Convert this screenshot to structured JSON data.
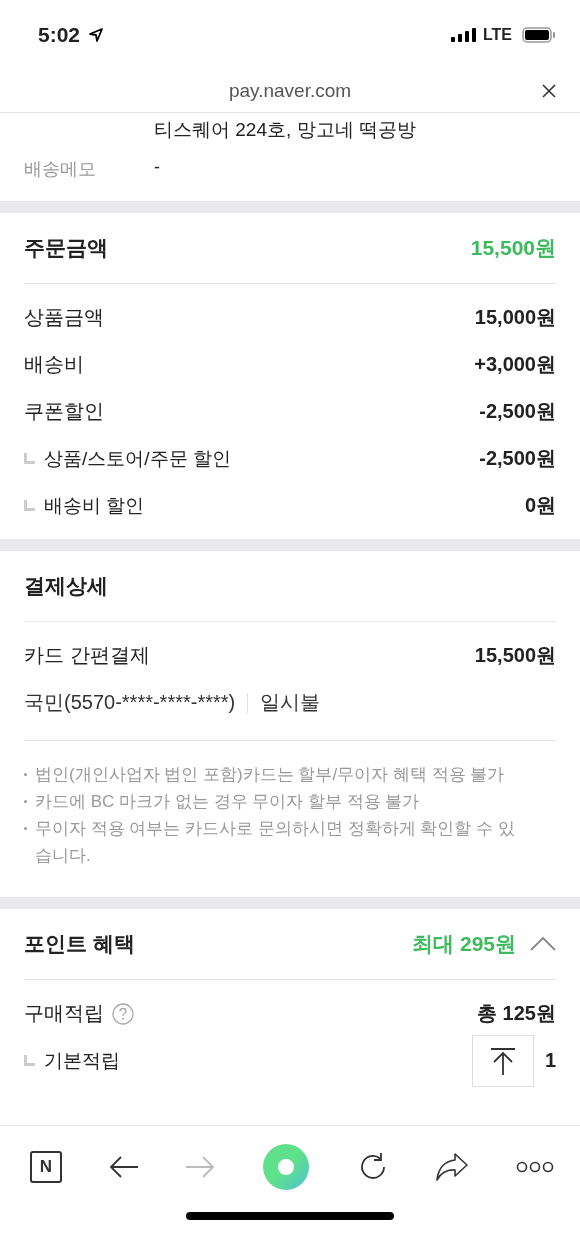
{
  "status_bar": {
    "time": "5:02",
    "network": "LTE"
  },
  "browser": {
    "url": "pay.naver.com"
  },
  "address": {
    "line": "티스퀘어 224호, 망고네 떡공방",
    "memo_label": "배송메모",
    "memo_value": "-"
  },
  "order": {
    "title": "주문금액",
    "total": "15,500원",
    "rows": [
      {
        "label": "상품금액",
        "value": "15,000원",
        "sub": false
      },
      {
        "label": "배송비",
        "value": "+3,000원",
        "sub": false
      },
      {
        "label": "쿠폰할인",
        "value": "-2,500원",
        "sub": false
      },
      {
        "label": "상품/스토어/주문 할인",
        "value": "-2,500원",
        "sub": true
      },
      {
        "label": "배송비 할인",
        "value": "0원",
        "sub": true
      }
    ]
  },
  "payment": {
    "title": "결제상세",
    "method": "카드 간편결제",
    "amount": "15,500원",
    "card": "국민(5570-****-****-****)",
    "installment": "일시불",
    "notes": [
      "법인(개인사업자 법인 포함)카드는 할부/무이자 혜택 적용 불가",
      "카드에 BC 마크가 없는 경우 무이자 할부 적용 불가",
      "무이자 적용 여부는 카드사로 문의하시면 정확하게 확인할 수 있습니다."
    ]
  },
  "points": {
    "title": "포인트 혜택",
    "max": "최대 295원",
    "expanded": true,
    "rows": [
      {
        "label": "구매적립",
        "value": "총 125원",
        "sub": false,
        "help": true
      },
      {
        "label": "기본적립",
        "value": "1",
        "sub": true,
        "help": false
      }
    ]
  },
  "bottom_bar": {
    "logo": "N",
    "forward_disabled": true
  }
}
